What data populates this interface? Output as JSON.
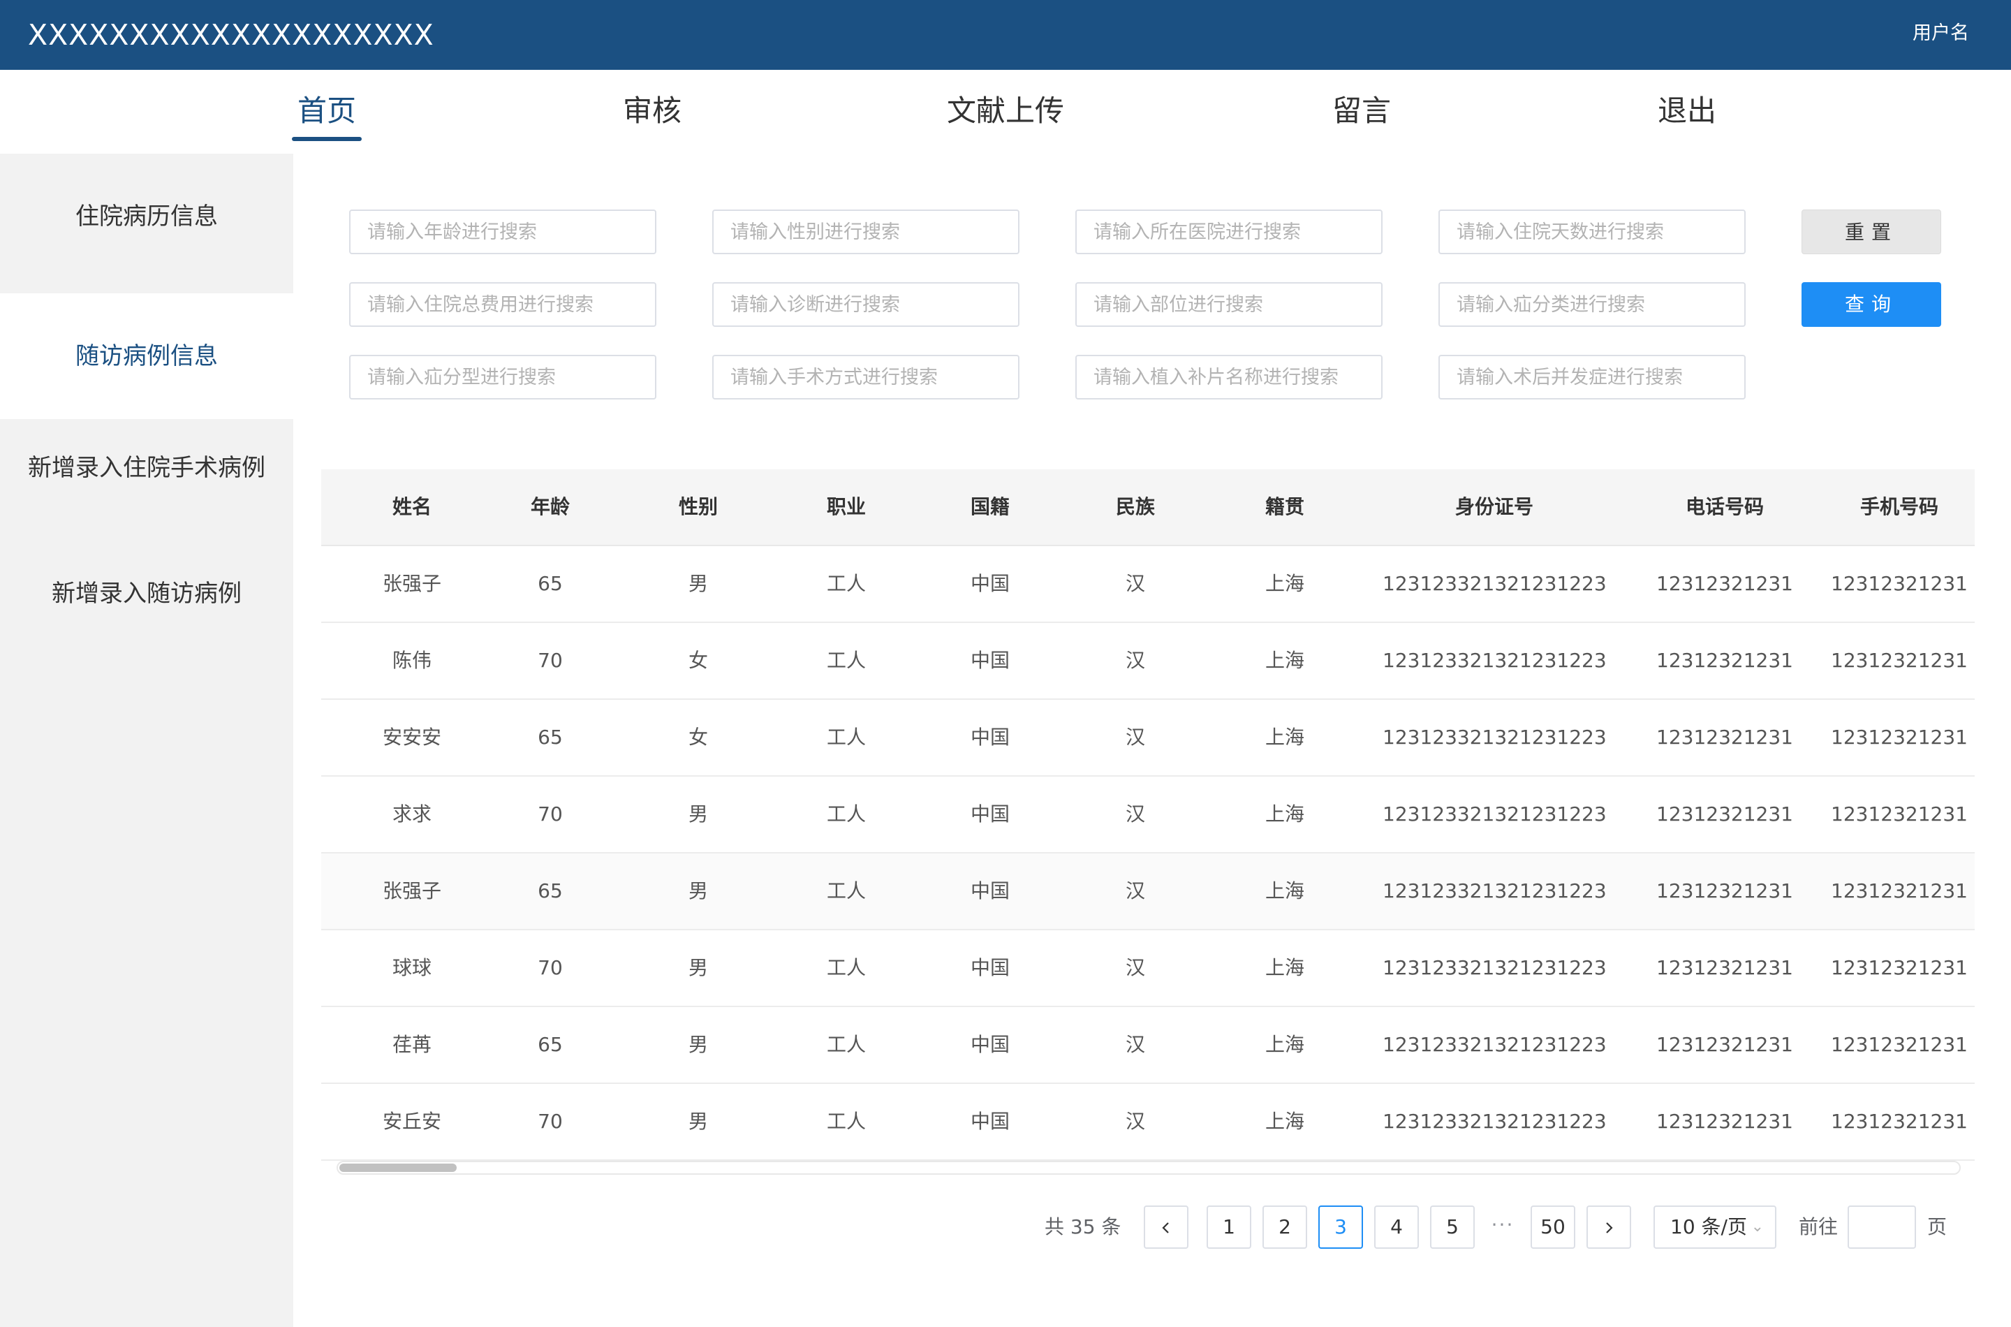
{
  "header": {
    "app_title": "XXXXXXXXXXXXXXXXXXXX",
    "username": "用户名",
    "background_color": "#1b5082"
  },
  "nav": {
    "tabs": [
      {
        "label": "首页",
        "active": true
      },
      {
        "label": "审核",
        "active": false
      },
      {
        "label": "文献上传",
        "active": false
      },
      {
        "label": "留言",
        "active": false
      },
      {
        "label": "退出",
        "active": false
      }
    ],
    "active_color": "#1b5082"
  },
  "sidebar": {
    "items": [
      {
        "label": "住院病历信息",
        "active": false
      },
      {
        "label": "随访病例信息",
        "active": true
      },
      {
        "label": "新增录入住院手术病例",
        "active": false
      },
      {
        "label": "新增录入随访病例",
        "active": false
      }
    ]
  },
  "search": {
    "fields": [
      {
        "placeholder": "请输入年龄进行搜索",
        "value": ""
      },
      {
        "placeholder": "请输入性别进行搜索",
        "value": ""
      },
      {
        "placeholder": "请输入所在医院进行搜索",
        "value": ""
      },
      {
        "placeholder": "请输入住院天数进行搜索",
        "value": ""
      },
      {
        "placeholder": "请输入住院总费用进行搜索",
        "value": ""
      },
      {
        "placeholder": "请输入诊断进行搜索",
        "value": ""
      },
      {
        "placeholder": "请输入部位进行搜索",
        "value": ""
      },
      {
        "placeholder": "请输入疝分类进行搜索",
        "value": ""
      },
      {
        "placeholder": "请输入疝分型进行搜索",
        "value": ""
      },
      {
        "placeholder": "请输入手术方式进行搜索",
        "value": ""
      },
      {
        "placeholder": "请输入植入补片名称进行搜索",
        "value": ""
      },
      {
        "placeholder": "请输入术后并发症进行搜索",
        "value": ""
      }
    ],
    "reset_label": "重置",
    "query_label": "查询",
    "query_color": "#1e8ef5"
  },
  "table": {
    "columns": [
      "姓名",
      "年龄",
      "性别",
      "职业",
      "国籍",
      "民族",
      "籍贯",
      "身份证号",
      "电话号码",
      "手机号码"
    ],
    "rows": [
      {
        "highlight": false,
        "cells": [
          "张强子",
          "65",
          "男",
          "工人",
          "中国",
          "汉",
          "上海",
          "123123321321231223",
          "12312321231",
          "12312321231"
        ]
      },
      {
        "highlight": false,
        "cells": [
          "陈伟",
          "70",
          "女",
          "工人",
          "中国",
          "汉",
          "上海",
          "123123321321231223",
          "12312321231",
          "12312321231"
        ]
      },
      {
        "highlight": false,
        "cells": [
          "安安安",
          "65",
          "女",
          "工人",
          "中国",
          "汉",
          "上海",
          "123123321321231223",
          "12312321231",
          "12312321231"
        ]
      },
      {
        "highlight": false,
        "cells": [
          "求求",
          "70",
          "男",
          "工人",
          "中国",
          "汉",
          "上海",
          "123123321321231223",
          "12312321231",
          "12312321231"
        ]
      },
      {
        "highlight": true,
        "cells": [
          "张强子",
          "65",
          "男",
          "工人",
          "中国",
          "汉",
          "上海",
          "123123321321231223",
          "12312321231",
          "12312321231"
        ]
      },
      {
        "highlight": false,
        "cells": [
          "球球",
          "70",
          "男",
          "工人",
          "中国",
          "汉",
          "上海",
          "123123321321231223",
          "12312321231",
          "12312321231"
        ]
      },
      {
        "highlight": false,
        "cells": [
          "荏苒",
          "65",
          "男",
          "工人",
          "中国",
          "汉",
          "上海",
          "123123321321231223",
          "12312321231",
          "12312321231"
        ]
      },
      {
        "highlight": false,
        "cells": [
          "安丘安",
          "70",
          "男",
          "工人",
          "中国",
          "汉",
          "上海",
          "123123321321231223",
          "12312321231",
          "12312321231"
        ]
      }
    ]
  },
  "pagination": {
    "total_label": "共 35 条",
    "prev_icon": "chevron-left-icon",
    "next_icon": "chevron-right-icon",
    "pages": [
      {
        "label": "1",
        "active": false
      },
      {
        "label": "2",
        "active": false
      },
      {
        "label": "3",
        "active": true
      },
      {
        "label": "4",
        "active": false
      },
      {
        "label": "5",
        "active": false
      }
    ],
    "ellipsis": "···",
    "last_page": "50",
    "page_size": "10 条/页",
    "goto_prefix": "前往",
    "goto_value": "",
    "goto_suffix": "页"
  }
}
